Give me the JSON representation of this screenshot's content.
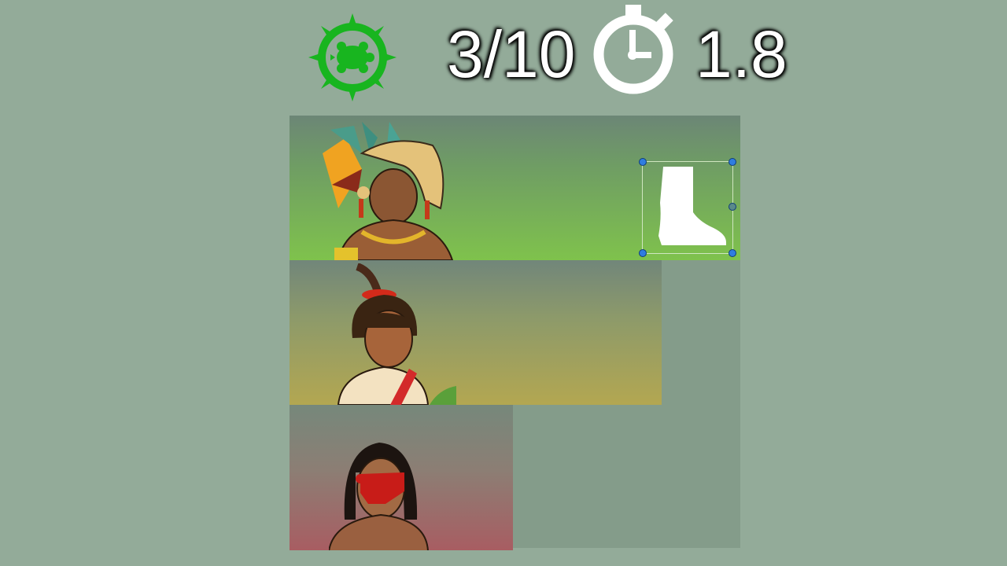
{
  "hud": {
    "badge_icon": "turtle-gear-icon",
    "badge_color": "#18b51f",
    "score": "3/10",
    "timer_icon": "stopwatch-icon",
    "time": "1.8"
  },
  "board": {
    "panels": [
      {
        "character": "aztec-warrior-feather-headdress",
        "background": "green",
        "item": "boot-silhouette-icon"
      },
      {
        "character": "boy-red-sash",
        "background": "yellow"
      },
      {
        "character": "man-red-face-paint",
        "background": "red"
      }
    ]
  }
}
